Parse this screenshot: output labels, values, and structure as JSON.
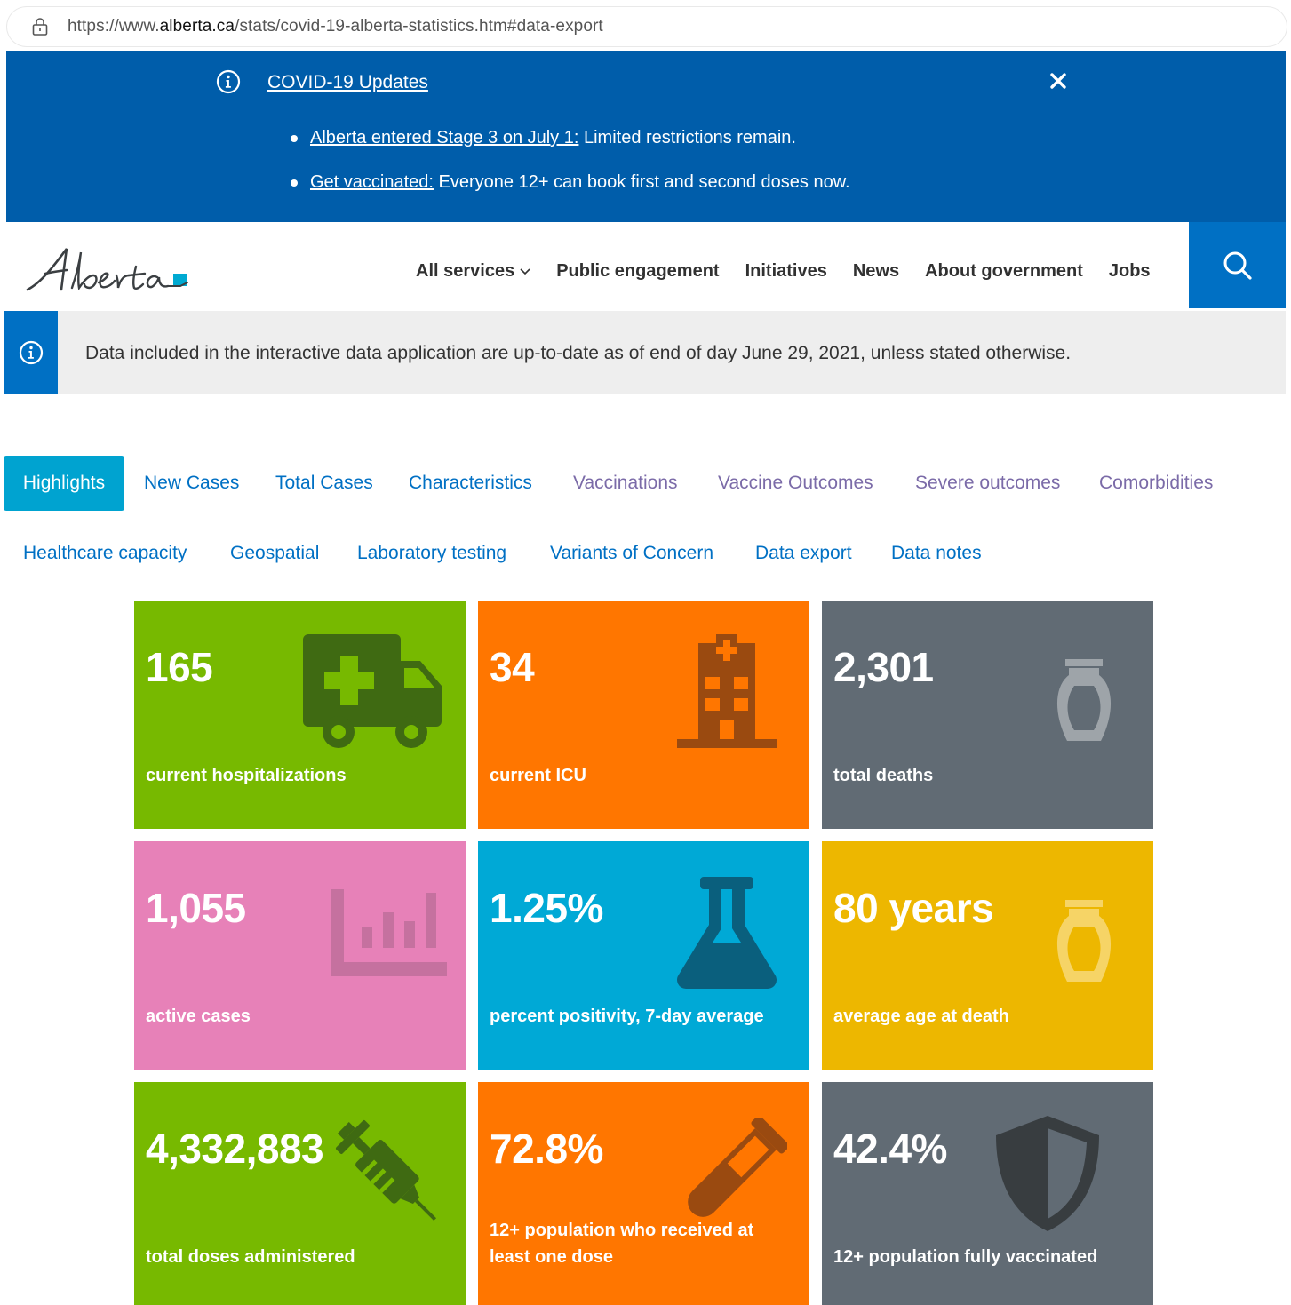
{
  "browser": {
    "url_prefix": "https://www.",
    "url_domain": "alberta.ca",
    "url_path": "/stats/covid-19-alberta-statistics.htm#data-export"
  },
  "banner": {
    "title": "COVID-19 Updates",
    "items": [
      {
        "link": "Alberta entered Stage 3 on July 1:",
        "text": " Limited restrictions remain."
      },
      {
        "link": "Get vaccinated:",
        "text": " Everyone 12+ can book first and second doses now."
      }
    ]
  },
  "header": {
    "nav": [
      "All services",
      "Public engagement",
      "Initiatives",
      "News",
      "About government",
      "Jobs"
    ]
  },
  "callout": {
    "text": "Data included in the interactive data application are up-to-date as of end of day June 29, 2021, unless stated otherwise."
  },
  "tabs": {
    "row1": [
      "Highlights",
      "New Cases",
      "Total Cases",
      "Characteristics",
      "Vaccinations",
      "Vaccine Outcomes",
      "Severe outcomes",
      "Comorbidities"
    ],
    "row2": [
      "Healthcare capacity",
      "Geospatial",
      "Laboratory testing",
      "Variants of Concern",
      "Data export",
      "Data notes"
    ]
  },
  "tiles": [
    {
      "value": "165",
      "label": "current hospitalizations",
      "color": "#77b900",
      "icon": "ambulance-icon"
    },
    {
      "value": "34",
      "label": "current ICU",
      "color": "#ff7600",
      "icon": "hospital-icon"
    },
    {
      "value": "2,301",
      "label": "total deaths",
      "color": "#616b74",
      "icon": "urn-icon"
    },
    {
      "value": "1,055",
      "label": "active cases",
      "color": "#e781b8",
      "icon": "bar-chart-icon"
    },
    {
      "value": "1.25%",
      "label": "percent positivity, 7-day average",
      "color": "#00a9d6",
      "icon": "flask-icon"
    },
    {
      "value": "80 years",
      "label": "average age at death",
      "color": "#edb700",
      "icon": "urn-icon"
    },
    {
      "value": "4,332,883",
      "label": "total doses administered",
      "color": "#77b900",
      "icon": "syringe-icon"
    },
    {
      "value": "72.8%",
      "label": "12+ population who received at least one dose",
      "label_line1": "12+ population who received at",
      "label_line2": "least one dose",
      "color": "#ff7600",
      "icon": "test-tube-icon"
    },
    {
      "value": "42.4%",
      "label": "12+ population fully vaccinated",
      "color": "#616b74",
      "icon": "shield-icon"
    }
  ]
}
